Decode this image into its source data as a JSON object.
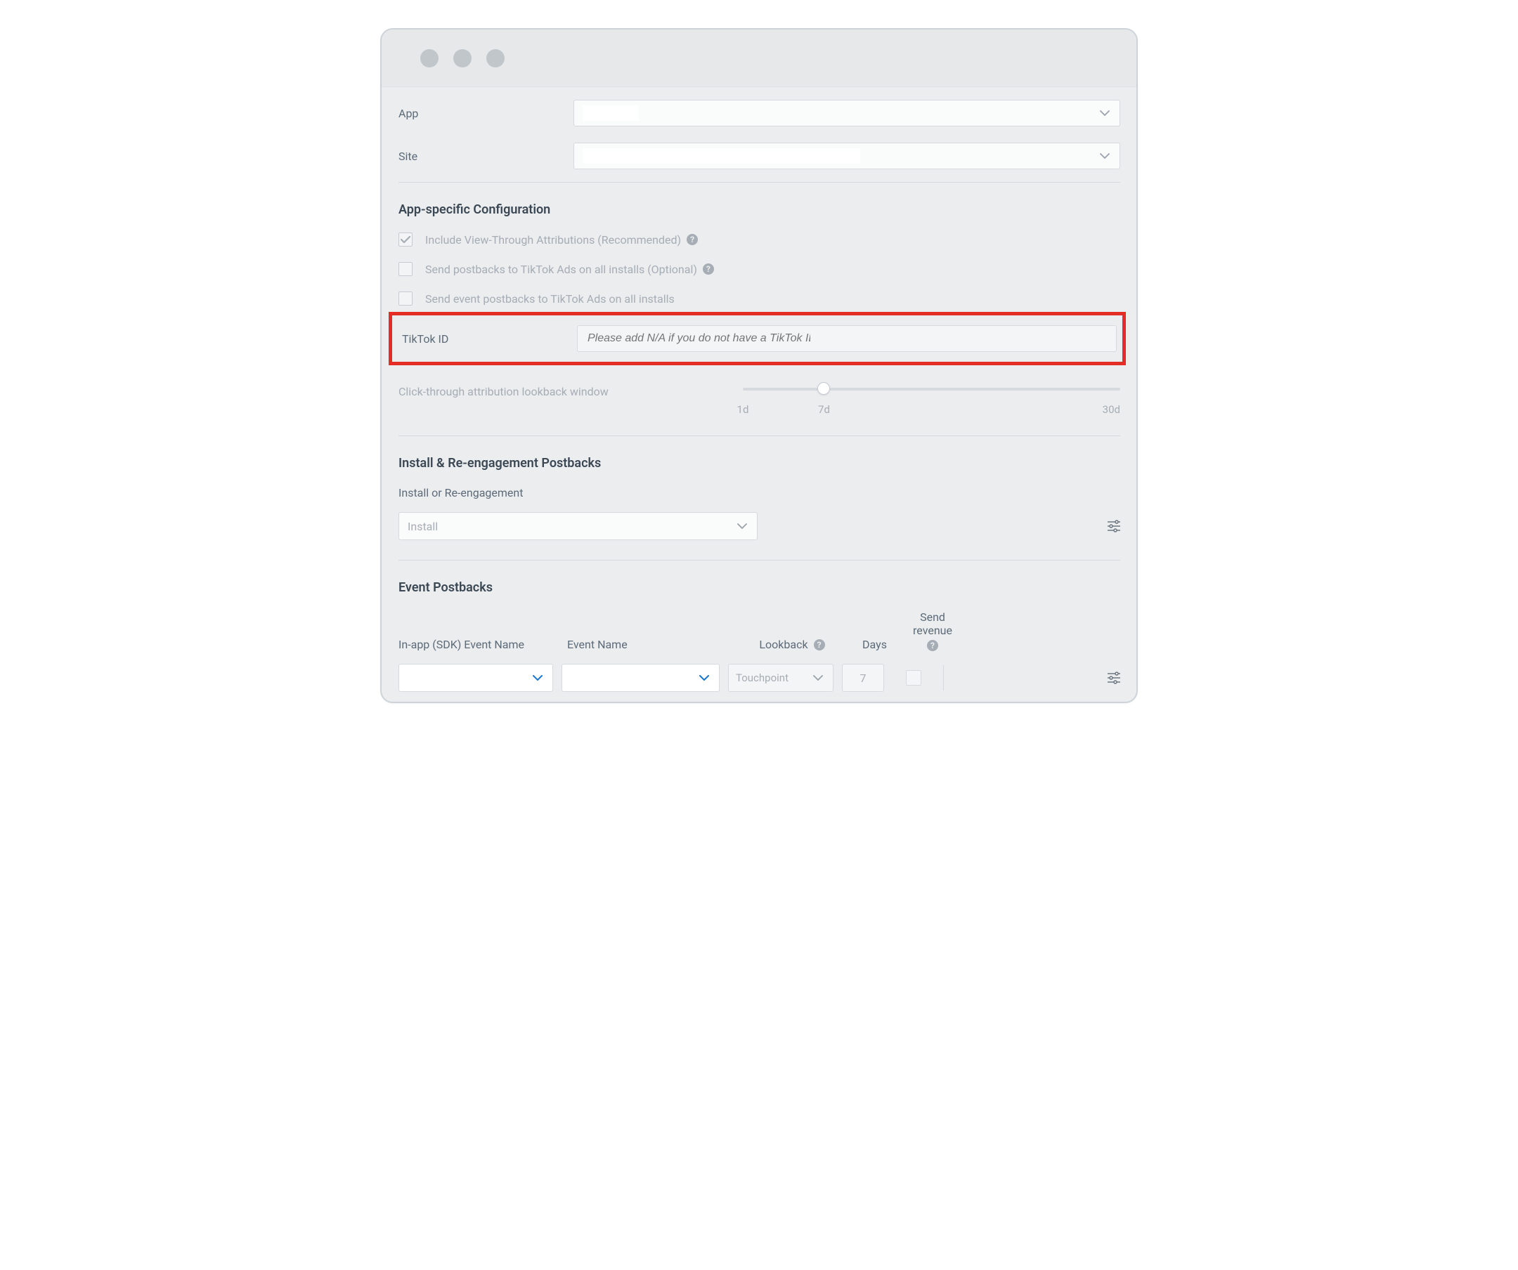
{
  "header": {
    "app_label": "App",
    "site_label": "Site"
  },
  "config": {
    "title": "App-specific Configuration",
    "checkbox1": "Include View-Through Attributions (Recommended)",
    "checkbox2": "Send postbacks to TikTok Ads on all installs (Optional)",
    "checkbox3": "Send event postbacks to TikTok Ads on all installs",
    "tiktok_id_label": "TikTok ID",
    "tiktok_id_placeholder": "Please add N/A if you do not have a TikTok ID",
    "slider_label": "Click-through attribution lookback window",
    "slider_marks": {
      "start": "1d",
      "mid": "7d",
      "end": "30d"
    }
  },
  "postbacks": {
    "title": "Install & Re-engagement Postbacks",
    "sub_label": "Install or Re-engagement",
    "select_value": "Install"
  },
  "events": {
    "title": "Event Postbacks",
    "col_sdk": "In-app (SDK) Event Name",
    "col_event": "Event Name",
    "col_lookback": "Lookback",
    "col_days": "Days",
    "col_revenue": "Send revenue",
    "touchpoint": "Touchpoint",
    "days_value": "7"
  }
}
